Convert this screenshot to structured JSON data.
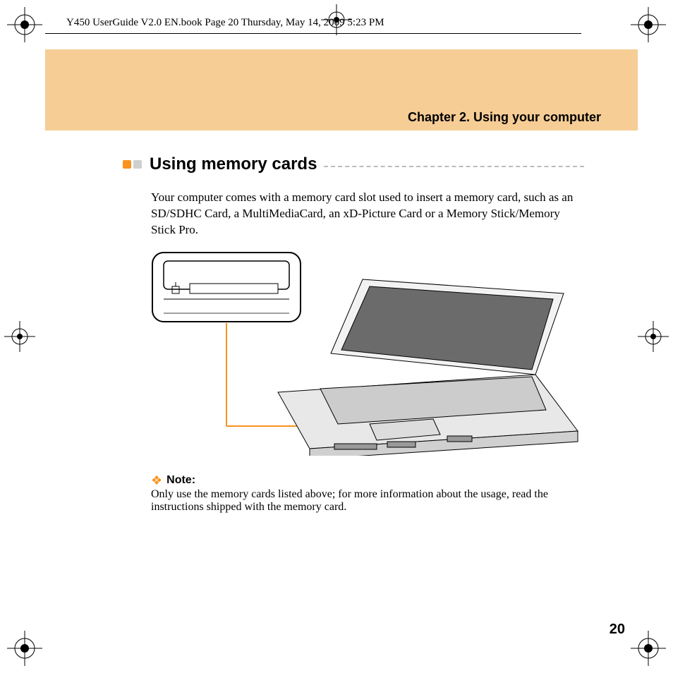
{
  "running_head": "Y450 UserGuide V2.0 EN.book  Page 20  Thursday, May 14, 2009  5:23 PM",
  "chapter_title": "Chapter 2. Using your computer",
  "section_title": "Using memory cards",
  "intro_text": "Your computer comes with a memory card slot used to insert a memory card, such as an SD/SDHC Card, a MultiMediaCard, an xD-Picture Card or a Memory Stick/Memory Stick Pro.",
  "note": {
    "label": "Note:",
    "text": "Only use the memory cards listed above; for more information about the usage, read the instructions shipped with the memory card."
  },
  "page_number": "20"
}
